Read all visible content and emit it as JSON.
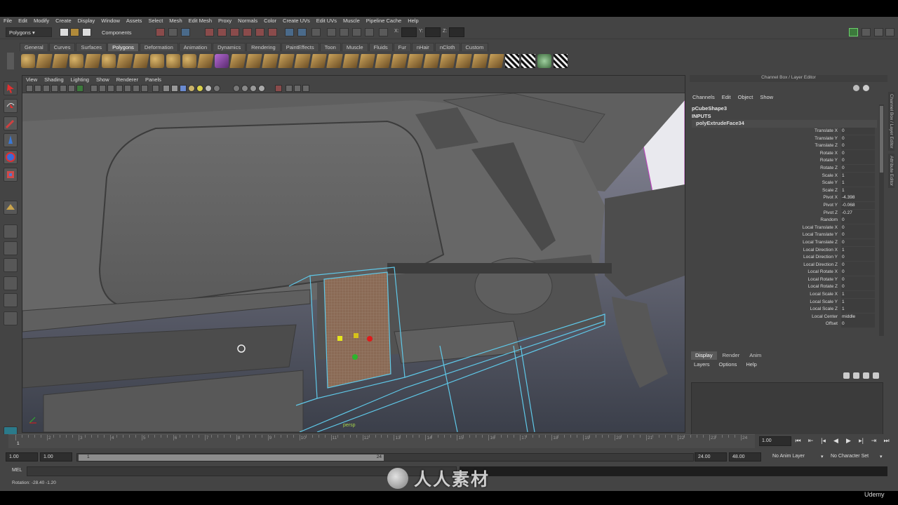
{
  "menubar": [
    "File",
    "Edit",
    "Modify",
    "Create",
    "Display",
    "Window",
    "Assets",
    "Select",
    "Mesh",
    "Edit Mesh",
    "Proxy",
    "Normals",
    "Color",
    "Create UVs",
    "Edit UVs",
    "Muscle",
    "Pipeline Cache",
    "Help"
  ],
  "statusline": {
    "mode": "Polygons",
    "selection_mask": "Components",
    "x_label": "X:",
    "y_label": "Y:",
    "z_label": "Z:"
  },
  "shelf": {
    "tabs": [
      "General",
      "Curves",
      "Surfaces",
      "Polygons",
      "Deformation",
      "Animation",
      "Dynamics",
      "Rendering",
      "PaintEffects",
      "Toon",
      "Muscle",
      "Fluids",
      "Fur",
      "nHair",
      "nCloth",
      "Custom"
    ],
    "active_tab": "Polygons"
  },
  "viewport": {
    "menu": [
      "View",
      "Shading",
      "Lighting",
      "Show",
      "Renderer",
      "Panels"
    ],
    "camera_label": "persp"
  },
  "channel_box": {
    "title": "Channel Box / Layer Editor",
    "menu": [
      "Channels",
      "Edit",
      "Object",
      "Show"
    ],
    "shape_node": "pCubeShape3",
    "inputs_label": "INPUTS",
    "input_node": "polyExtrudeFace34",
    "attributes": [
      {
        "name": "Translate X",
        "value": "0"
      },
      {
        "name": "Translate Y",
        "value": "0"
      },
      {
        "name": "Translate Z",
        "value": "0"
      },
      {
        "name": "Rotate X",
        "value": "0"
      },
      {
        "name": "Rotate Y",
        "value": "0"
      },
      {
        "name": "Rotate Z",
        "value": "0"
      },
      {
        "name": "Scale X",
        "value": "1"
      },
      {
        "name": "Scale Y",
        "value": "1"
      },
      {
        "name": "Scale Z",
        "value": "1"
      },
      {
        "name": "Pivot X",
        "value": "-4.398"
      },
      {
        "name": "Pivot Y",
        "value": "-0.068"
      },
      {
        "name": "Pivot Z",
        "value": "-0.27"
      },
      {
        "name": "Random",
        "value": "0"
      },
      {
        "name": "Local Translate X",
        "value": "0"
      },
      {
        "name": "Local Translate Y",
        "value": "0"
      },
      {
        "name": "Local Translate Z",
        "value": "0"
      },
      {
        "name": "Local Direction X",
        "value": "1"
      },
      {
        "name": "Local Direction Y",
        "value": "0"
      },
      {
        "name": "Local Direction Z",
        "value": "0"
      },
      {
        "name": "Local Rotate X",
        "value": "0"
      },
      {
        "name": "Local Rotate Y",
        "value": "0"
      },
      {
        "name": "Local Rotate Z",
        "value": "0"
      },
      {
        "name": "Local Scale X",
        "value": "1"
      },
      {
        "name": "Local Scale Y",
        "value": "1"
      },
      {
        "name": "Local Scale Z",
        "value": "1"
      },
      {
        "name": "Local Center",
        "value": "middle"
      },
      {
        "name": "Offset",
        "value": "0"
      }
    ],
    "side_tabs": [
      "Channel Box / Layer Editor",
      "Attribute Editor"
    ]
  },
  "layer_editor": {
    "tabs": [
      "Display",
      "Render",
      "Anim"
    ],
    "active_tab": "Display",
    "menu": [
      "Layers",
      "Options",
      "Help"
    ]
  },
  "time_slider": {
    "ticks": [
      "1",
      "2",
      "3",
      "4",
      "5",
      "6",
      "7",
      "8",
      "9",
      "10",
      "11",
      "12",
      "13",
      "14",
      "15",
      "16",
      "17",
      "18",
      "19",
      "20",
      "21",
      "22",
      "23",
      "24"
    ],
    "current_frame": "1.00"
  },
  "range_slider": {
    "start": "1.00",
    "range_start": "1.00",
    "thumb_start": "1",
    "thumb_end": "24",
    "range_end": "24.00",
    "end": "48.00",
    "anim_layer": "No Anim Layer",
    "character_set": "No Character Set"
  },
  "command_line": {
    "label": "MEL"
  },
  "help_line": {
    "text": "Rotation: -28.40   -1.20"
  },
  "watermark": {
    "text": "人人素材",
    "brand": "Udemy"
  }
}
